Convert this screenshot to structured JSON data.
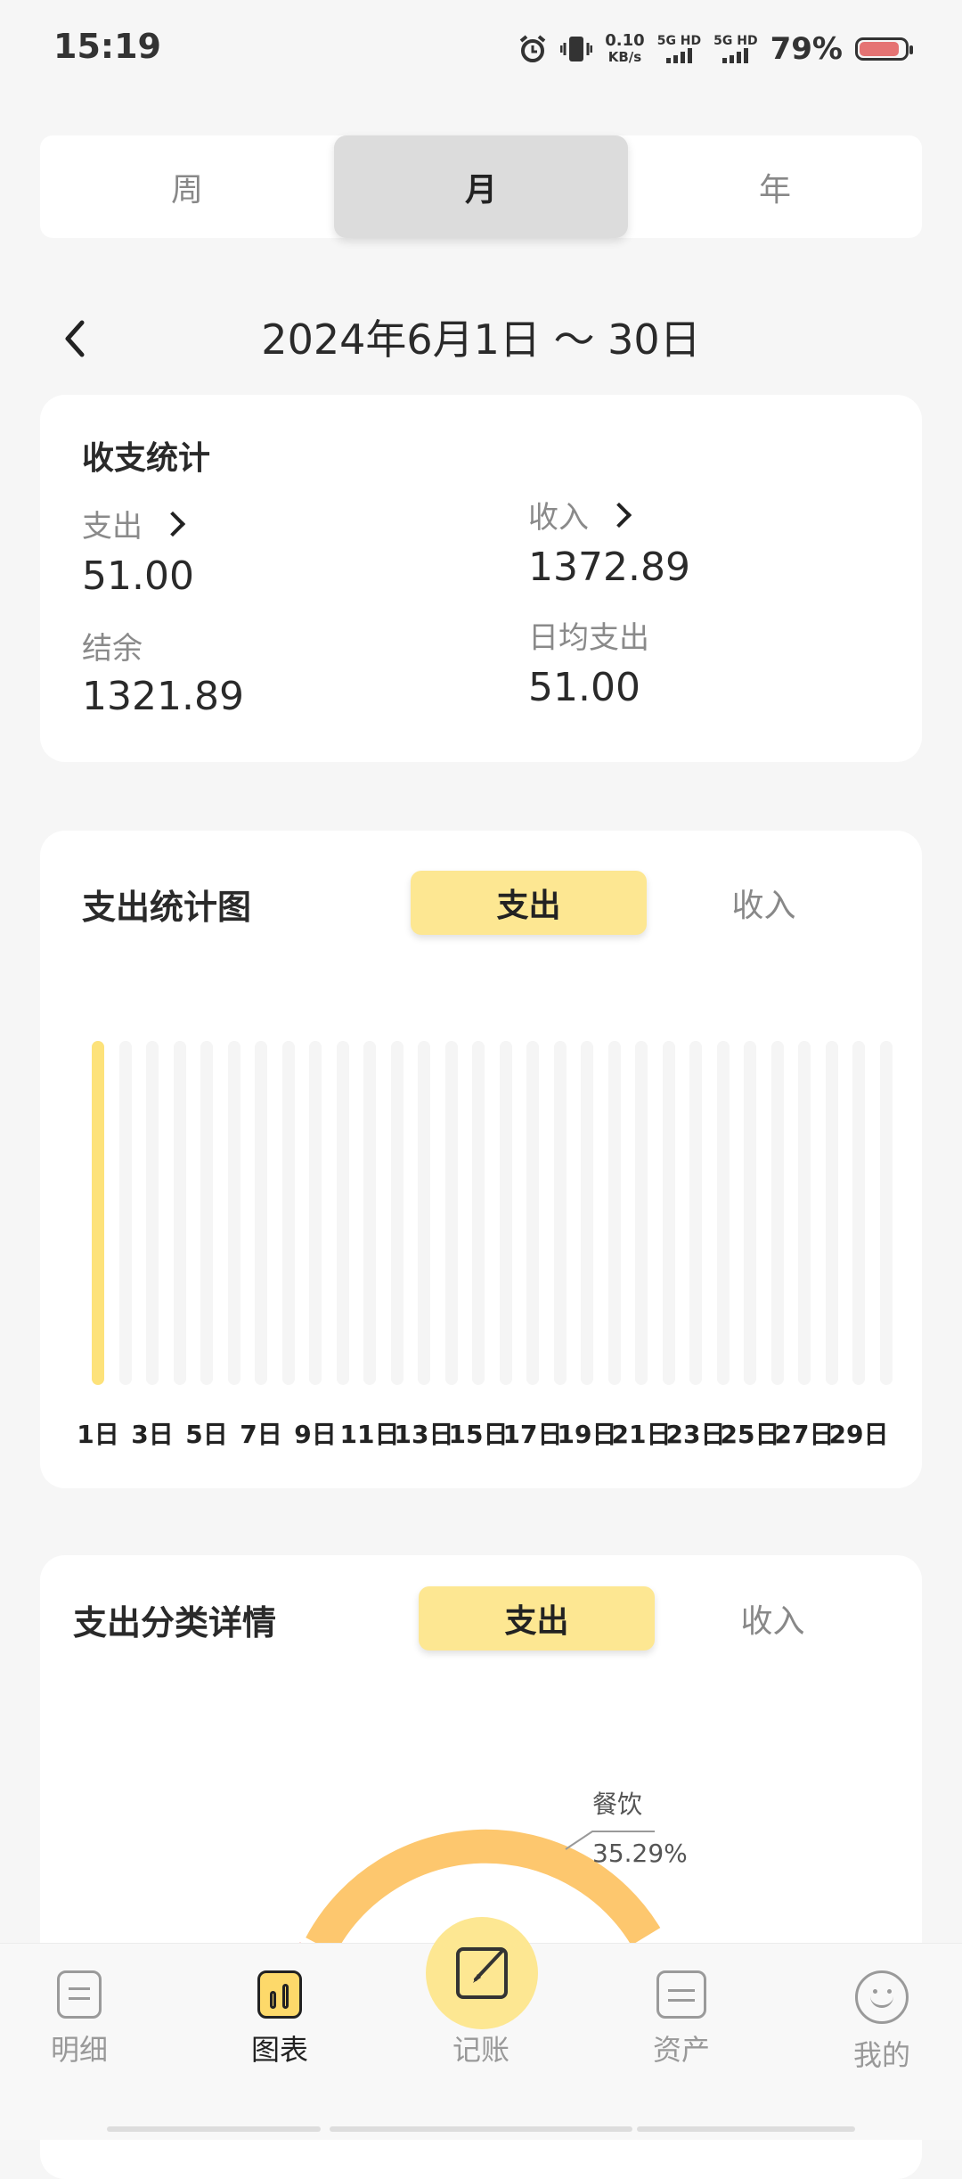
{
  "status": {
    "time": "15:19",
    "net_speed": "0.10",
    "net_unit": "KB/s",
    "sim1": "5G HD",
    "sim2": "5G HD",
    "battery": "79%"
  },
  "tabs": [
    {
      "label": "周",
      "active": false
    },
    {
      "label": "月",
      "active": true
    },
    {
      "label": "年",
      "active": false
    }
  ],
  "date_range": "2024年6月1日 ～ 30日",
  "summary": {
    "title": "收支统计",
    "expense_label": "支出",
    "expense_value": "51.00",
    "income_label": "收入",
    "income_value": "1372.89",
    "balance_label": "结余",
    "balance_value": "1321.89",
    "daily_label": "日均支出",
    "daily_value": "51.00"
  },
  "expense_chart": {
    "title": "支出统计图",
    "toggle_expense": "支出",
    "toggle_income": "收入"
  },
  "chart_data": {
    "type": "bar",
    "categories": [
      "1日",
      "2日",
      "3日",
      "4日",
      "5日",
      "6日",
      "7日",
      "8日",
      "9日",
      "10日",
      "11日",
      "12日",
      "13日",
      "14日",
      "15日",
      "16日",
      "17日",
      "18日",
      "19日",
      "20日",
      "21日",
      "22日",
      "23日",
      "24日",
      "25日",
      "26日",
      "27日",
      "28日",
      "29日",
      "30日"
    ],
    "tick_labels": [
      "1日",
      "3日",
      "5日",
      "7日",
      "9日",
      "11日",
      "13日",
      "15日",
      "17日",
      "19日",
      "21日",
      "23日",
      "25日",
      "27日",
      "29日"
    ],
    "values": [
      51,
      0,
      0,
      0,
      0,
      0,
      0,
      0,
      0,
      0,
      0,
      0,
      0,
      0,
      0,
      0,
      0,
      0,
      0,
      0,
      0,
      0,
      0,
      0,
      0,
      0,
      0,
      0,
      0,
      0
    ],
    "ylim": [
      0,
      51
    ],
    "colors": {
      "bar": "#fde27a",
      "track": "#f5f5f5"
    }
  },
  "category_detail": {
    "title": "支出分类详情",
    "toggle_expense": "支出",
    "toggle_income": "收入",
    "slice_label": "餐饮",
    "slice_percent": "35.29%"
  },
  "nav": [
    {
      "label": "明细",
      "icon": "list-icon"
    },
    {
      "label": "图表",
      "icon": "chart-icon"
    },
    {
      "label": "记账",
      "icon": "edit-icon"
    },
    {
      "label": "资产",
      "icon": "wallet-icon"
    },
    {
      "label": "我的",
      "icon": "smile-icon"
    }
  ]
}
